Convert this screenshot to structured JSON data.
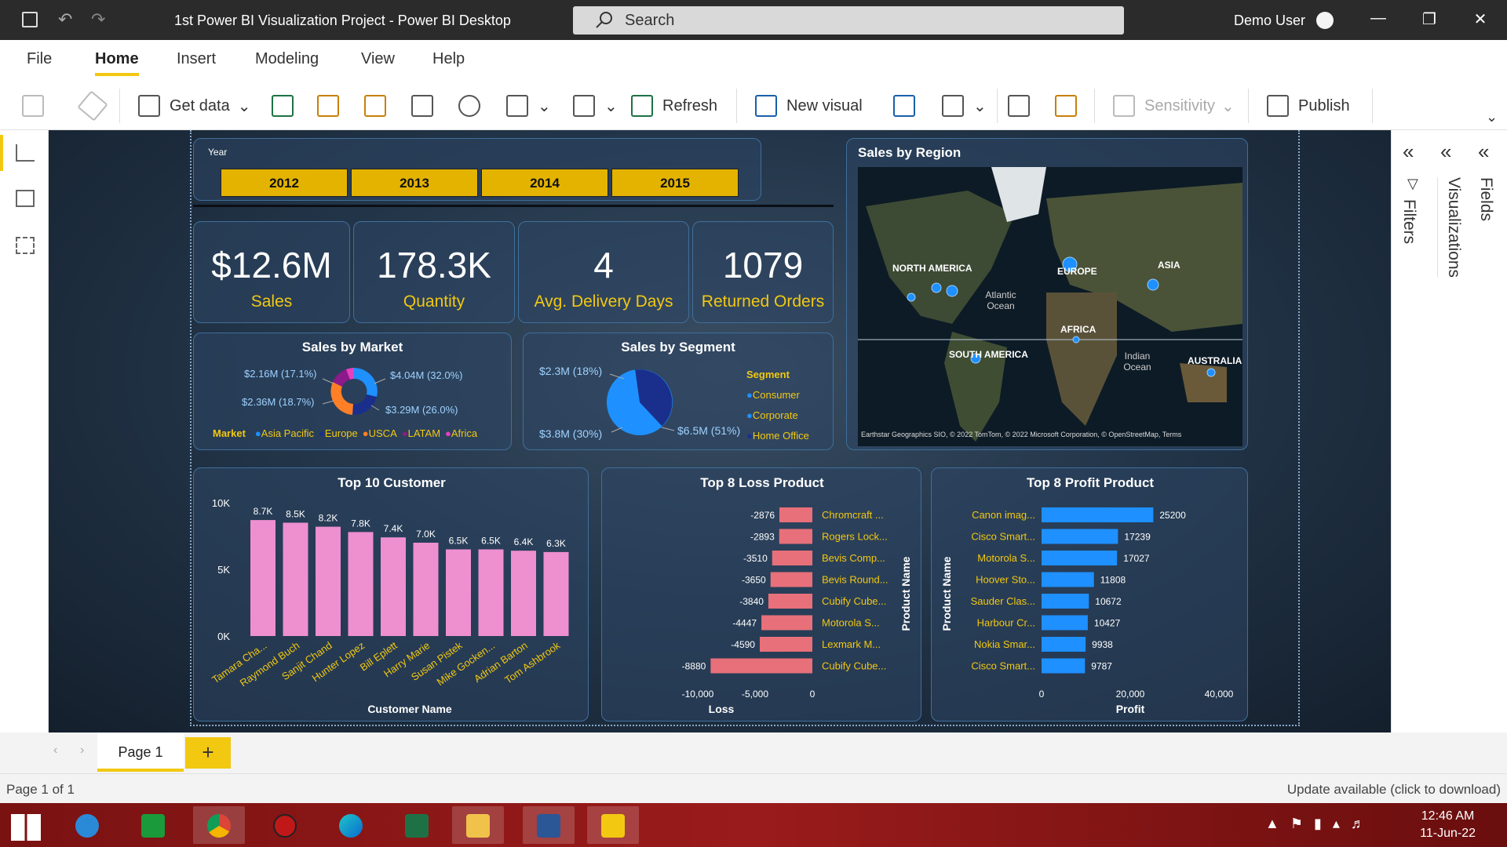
{
  "window": {
    "title": "1st Power BI Visualization Project - Power BI Desktop",
    "search_placeholder": "Search",
    "user": "Demo User"
  },
  "menu": [
    "File",
    "Home",
    "Insert",
    "Modeling",
    "View",
    "Help"
  ],
  "ribbon": {
    "get_data": "Get data",
    "refresh": "Refresh",
    "new_visual": "New visual",
    "sensitivity": "Sensitivity",
    "publish": "Publish"
  },
  "slicer": {
    "label": "Year",
    "years": [
      "2012",
      "2013",
      "2014",
      "2015"
    ]
  },
  "kpis": [
    {
      "value": "$12.6M",
      "label": "Sales"
    },
    {
      "value": "178.3K",
      "label": "Quantity"
    },
    {
      "value": "4",
      "label": "Avg. Delivery Days"
    },
    {
      "value": "1079",
      "label": "Returned Orders"
    }
  ],
  "sales_by_market": {
    "title": "Sales by Market",
    "legend_title": "Market",
    "labels": {
      "l1": "$2.16M (17.1%)",
      "l2": "$2.36M (18.7%)",
      "r1": "$4.04M (32.0%)",
      "r2": "$3.29M (26.0%)"
    },
    "legend": [
      {
        "name": "Asia Pacific",
        "color": "#1e90ff"
      },
      {
        "name": "Europe",
        "color": "#1a2f8c"
      },
      {
        "name": "USCA",
        "color": "#ff7f27"
      },
      {
        "name": "LATAM",
        "color": "#8b1a8b"
      },
      {
        "name": "Africa",
        "color": "#e83fbf"
      }
    ]
  },
  "sales_by_segment": {
    "title": "Sales by Segment",
    "legend_title": "Segment",
    "labels": {
      "a": "$2.3M (18%)",
      "b": "$3.8M (30%)",
      "c": "$6.5M (51%)"
    },
    "legend": [
      {
        "name": "Consumer",
        "color": "#1e90ff"
      },
      {
        "name": "Corporate",
        "color": "#1e90ff"
      },
      {
        "name": "Home Office",
        "color": "#1a2f8c"
      }
    ]
  },
  "map": {
    "title": "Sales by Region",
    "labels": [
      "NORTH AMERICA",
      "EUROPE",
      "ASIA",
      "AFRICA",
      "SOUTH AMERICA",
      "AUSTRALIA",
      "Atlantic Ocean",
      "Indian Ocean"
    ],
    "attribution": "Earthstar Geographics SIO, © 2022 TomTom, © 2022 Microsoft Corporation, © OpenStreetMap, Terms"
  },
  "chart_data": [
    {
      "type": "bar",
      "title": "Top 10 Customer",
      "xlabel": "Customer Name",
      "ylabel": "",
      "ylim": [
        0,
        10000
      ],
      "yticks": [
        "10K",
        "5K",
        "0K"
      ],
      "categories": [
        "Tamara Cha...",
        "Raymond Buch",
        "Sanjit Chand",
        "Hunter Lopez",
        "Bill Eplett",
        "Harry Marie",
        "Susan Pistek",
        "Mike Gocken...",
        "Adrian Barton",
        "Tom Ashbrook"
      ],
      "values": [
        8700,
        8500,
        8200,
        7800,
        7400,
        7000,
        6500,
        6500,
        6400,
        6300
      ],
      "data_labels": [
        "8.7K",
        "8.5K",
        "8.2K",
        "7.8K",
        "7.4K",
        "7.0K",
        "6.5K",
        "6.5K",
        "6.4K",
        "6.3K"
      ],
      "color": "#ee8fd0"
    },
    {
      "type": "bar",
      "title": "Top 8 Loss Product",
      "xlabel": "Loss",
      "ylabel": "Product Name",
      "xlim": [
        -10000,
        0
      ],
      "xticks": [
        "-10,000",
        "-5,000",
        "0"
      ],
      "categories": [
        "Chromcraft ...",
        "Rogers Lock...",
        "Bevis Comp...",
        "Bevis Round...",
        "Cubify Cube...",
        "Motorola S...",
        "Lexmark M...",
        "Cubify Cube..."
      ],
      "values": [
        -2876,
        -2893,
        -3510,
        -3650,
        -3840,
        -4447,
        -4590,
        -8880
      ],
      "color": "#e8707a"
    },
    {
      "type": "bar",
      "title": "Top 8 Profit Product",
      "xlabel": "Profit",
      "ylabel": "Product Name",
      "xlim": [
        0,
        40000
      ],
      "xticks": [
        "0",
        "20,000",
        "40,000"
      ],
      "categories": [
        "Canon imag...",
        "Cisco Smart...",
        "Motorola S...",
        "Hoover Sto...",
        "Sauder Clas...",
        "Harbour Cr...",
        "Nokia Smar...",
        "Cisco Smart..."
      ],
      "values": [
        25200,
        17239,
        17027,
        11808,
        10672,
        10427,
        9938,
        9787
      ],
      "color": "#1e90ff"
    }
  ],
  "panes": {
    "filters": "Filters",
    "visualizations": "Visualizations",
    "fields": "Fields"
  },
  "pages": {
    "tab": "Page 1",
    "add": "+"
  },
  "status": {
    "left": "Page 1 of 1",
    "right": "Update available (click to download)"
  },
  "clock": {
    "time": "12:46 AM",
    "date": "11-Jun-22"
  }
}
